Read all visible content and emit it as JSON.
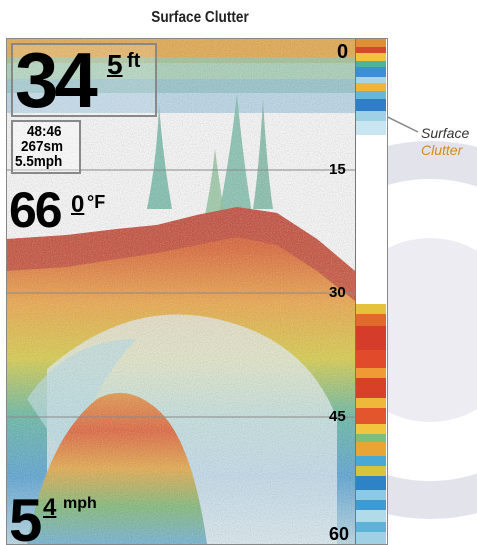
{
  "caption": {
    "title": "Surface Clutter"
  },
  "callout": {
    "line1": "Surface",
    "line2": "Clutter"
  },
  "display": {
    "depth": {
      "value": "34",
      "decimal": "5",
      "unit": "ft"
    },
    "time": "48:46",
    "distance": "267sm",
    "speed_small": "5.5mph",
    "temperature": {
      "value": "66",
      "decimal": "0",
      "unit": "°F"
    },
    "speed": {
      "value": "5",
      "decimal": "4",
      "unit": "mph"
    },
    "scale": [
      "0",
      "15",
      "30",
      "45",
      "60"
    ]
  },
  "colors": {
    "strong_return": "#d9401f",
    "medium_return": "#f0b020",
    "weak_return": "#3fa0d8",
    "faint_return": "#b9dde8",
    "callout_accent": "#d58a1c"
  }
}
